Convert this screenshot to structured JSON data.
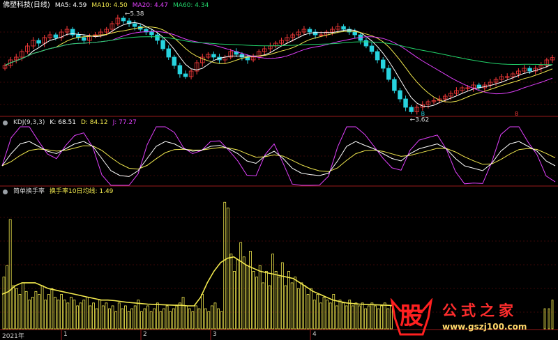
{
  "main_panel": {
    "title": "佛塑科技(日线)",
    "ma_labels": [
      {
        "name": "MA5: 4.59",
        "color": "#ffffff"
      },
      {
        "name": "MA10: 4.50",
        "color": "#f2e94e"
      },
      {
        "name": "MA20: 4.47",
        "color": "#e040fb"
      },
      {
        "name": "MA60: 4.34",
        "color": "#22d36a"
      }
    ],
    "high_annotation": "5.38",
    "low_annotation": "3.62",
    "marker_right": "8",
    "marker_low": "B"
  },
  "kdj_panel": {
    "title": "KDJ(9,3,3)",
    "labels": [
      {
        "name": "K: 68.51",
        "color": "#ffffff"
      },
      {
        "name": "D: 84.12",
        "color": "#f2e94e"
      },
      {
        "name": "J: 77.27",
        "color": "#e040fb"
      }
    ]
  },
  "turnover_panel": {
    "title": "简单换手率",
    "ma_label": "换手率10日均线: 1.49",
    "ma_color": "#f2e94e"
  },
  "x_labels": [
    "2021年",
    "1",
    "2",
    "3",
    "4"
  ],
  "watermark": {
    "logo": "股",
    "title": "公式之家",
    "url": "www.gszj100.com"
  },
  "colors": {
    "up": "#ff3b3b",
    "down": "#27d3df",
    "bar": "#f2e94e",
    "grid": "#7a1010"
  },
  "chart_data": [
    {
      "type": "candlestick",
      "title": "佛塑科技(日线)",
      "high": 5.38,
      "low": 3.62,
      "ma": {
        "MA5": 4.59,
        "MA10": 4.5,
        "MA20": 4.47,
        "MA60": 4.34
      },
      "close": [
        4.45,
        4.55,
        4.6,
        4.7,
        4.8,
        4.9,
        4.85,
        4.95,
        5.0,
        4.95,
        5.05,
        5.1,
        5.0,
        4.95,
        4.9,
        4.98,
        5.0,
        5.05,
        5.1,
        5.2,
        5.3,
        5.25,
        5.2,
        5.15,
        5.1,
        5.05,
        5.0,
        4.9,
        4.75,
        4.6,
        4.45,
        4.3,
        4.25,
        4.35,
        4.5,
        4.6,
        4.65,
        4.6,
        4.55,
        4.6,
        4.7,
        4.65,
        4.6,
        4.55,
        4.6,
        4.7,
        4.75,
        4.8,
        4.85,
        4.9,
        4.95,
        5.0,
        5.05,
        5.1,
        5.05,
        5.0,
        5.0,
        5.05,
        5.1,
        5.15,
        5.1,
        5.05,
        5.0,
        4.9,
        4.8,
        4.7,
        4.55,
        4.4,
        4.2,
        4.0,
        3.85,
        3.7,
        3.62,
        3.7,
        3.75,
        3.8,
        3.82,
        3.85,
        3.9,
        3.95,
        4.0,
        4.05,
        4.05,
        4.1,
        4.05,
        4.1,
        4.15,
        4.2,
        4.25,
        4.25,
        4.3,
        4.35,
        4.4,
        4.35,
        4.4,
        4.45,
        4.55,
        4.59
      ]
    },
    {
      "type": "line",
      "title": "KDJ(9,3,3)",
      "series": [
        {
          "name": "K",
          "value": 68.51
        },
        {
          "name": "D",
          "value": 84.12
        },
        {
          "name": "J",
          "value": 77.27
        }
      ],
      "k": [
        30,
        55,
        75,
        80,
        70,
        60,
        55,
        65,
        75,
        80,
        70,
        45,
        20,
        10,
        8,
        20,
        45,
        70,
        80,
        75,
        65,
        60,
        62,
        70,
        72,
        65,
        55,
        40,
        35,
        50,
        60,
        45,
        25,
        15,
        12,
        10,
        15,
        40,
        70,
        80,
        72,
        65,
        55,
        45,
        40,
        55,
        65,
        70,
        75,
        65,
        45,
        30,
        25,
        20,
        35,
        60,
        75,
        80,
        70,
        60,
        40,
        30
      ]
    },
    {
      "type": "bar",
      "title": "简单换手率",
      "ma_label": "换手率10日均线",
      "ma_value": 1.49,
      "values": [
        1.8,
        2.2,
        3.8,
        1.5,
        1.4,
        1.2,
        1.6,
        1.3,
        1.0,
        1.1,
        1.3,
        1.2,
        1.5,
        1.0,
        1.2,
        1.4,
        1.1,
        1.0,
        1.2,
        1.0,
        0.9,
        1.1,
        1.0,
        0.8,
        0.9,
        1.0,
        1.1,
        0.8,
        0.9,
        0.7,
        1.0,
        0.8,
        0.9,
        0.7,
        0.8,
        0.6,
        0.9,
        0.7,
        0.8,
        0.6,
        0.7,
        0.8,
        1.0,
        0.6,
        0.7,
        0.8,
        0.6,
        0.7,
        0.9,
        0.6,
        0.7,
        0.8,
        0.6,
        0.7,
        0.8,
        0.9,
        1.1,
        0.8,
        0.7,
        0.6,
        0.8,
        0.7,
        1.2,
        0.7,
        0.6,
        0.8,
        0.9,
        0.7,
        0.6,
        4.4,
        4.2,
        2.6,
        2.0,
        2.4,
        3.0,
        2.5,
        2.2,
        2.7,
        2.0,
        1.8,
        2.2,
        1.6,
        2.0,
        1.5,
        2.6,
        2.0,
        1.8,
        2.3,
        1.5,
        2.0,
        1.6,
        1.8,
        1.4,
        1.6,
        1.5,
        1.2,
        1.4,
        1.0,
        1.2,
        0.9,
        1.1,
        1.0,
        0.9,
        1.2,
        0.8,
        1.0,
        0.9,
        0.8,
        1.0,
        0.8,
        0.9,
        0.8,
        0.9,
        0.7,
        0.8,
        0.9,
        0.8,
        0.7,
        0.8,
        0.9,
        0.7,
        0.8
      ],
      "ma": [
        1.2,
        1.3,
        1.5,
        1.6,
        1.6,
        1.6,
        1.5,
        1.4,
        1.35,
        1.3,
        1.25,
        1.2,
        1.15,
        1.1,
        1.05,
        1.0,
        1.0,
        0.98,
        0.95,
        0.92,
        0.9,
        0.88,
        0.86,
        0.85,
        0.84,
        0.83,
        0.82,
        0.82,
        0.8,
        0.8,
        1.1,
        1.6,
        2.0,
        2.3,
        2.45,
        2.5,
        2.35,
        2.2,
        2.1,
        2.0,
        1.95,
        1.9,
        1.85,
        1.8,
        1.75,
        1.6,
        1.45,
        1.3,
        1.2,
        1.1,
        1.0,
        0.95,
        0.9,
        0.88,
        0.86,
        0.85,
        0.84,
        0.83,
        0.82,
        0.81
      ]
    }
  ]
}
